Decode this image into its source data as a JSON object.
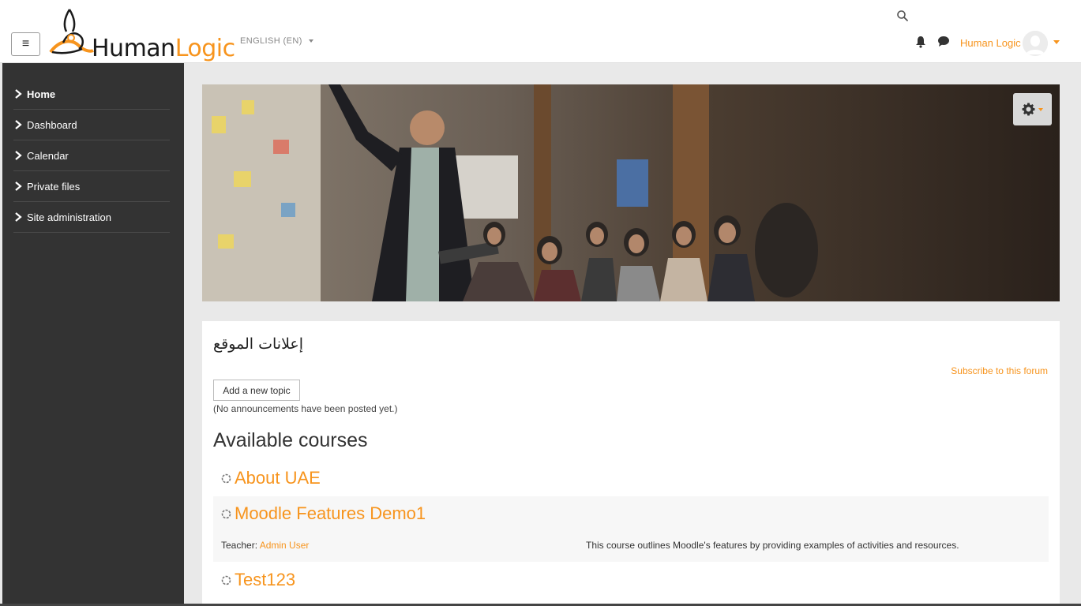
{
  "header": {
    "logo_human": "Human",
    "logo_logic": "Logic",
    "language": "ENGLISH (EN)",
    "user_name": "Human Logic"
  },
  "sidebar": {
    "items": [
      {
        "label": "Home",
        "active": true
      },
      {
        "label": "Dashboard",
        "active": false
      },
      {
        "label": "Calendar",
        "active": false
      },
      {
        "label": "Private files",
        "active": false
      },
      {
        "label": "Site administration",
        "active": false
      }
    ]
  },
  "forum": {
    "title": "إعلانات الموقع",
    "subscribe_label": "Subscribe to this forum",
    "add_topic_label": "Add a new topic",
    "empty_text": "(No announcements have been posted yet.)"
  },
  "courses": {
    "heading": "Available courses",
    "items": [
      {
        "name": "About UAE"
      },
      {
        "name": "Moodle Features Demo1",
        "teacher_prefix": "Teacher: ",
        "teacher": "Admin User",
        "summary": "This course outlines Moodle's features by providing examples of activities and resources."
      },
      {
        "name": "Test123"
      }
    ]
  },
  "colors": {
    "accent": "#f7941d",
    "sidebar_bg": "#333333",
    "page_bg": "#e9e9e9"
  },
  "icons": [
    "menu-icon",
    "search-icon",
    "bell-icon",
    "chat-icon",
    "avatar",
    "gear-icon",
    "chevron-right-icon",
    "course-icon"
  ]
}
